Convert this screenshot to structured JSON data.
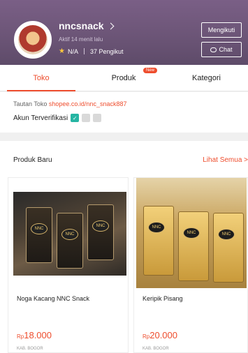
{
  "shop": {
    "name": "nncsnack",
    "active_status": "Aktif 14 menit lalu",
    "rating": "N/A",
    "followers": "37 Pengikut",
    "follow_label": "Mengikuti",
    "chat_label": "Chat"
  },
  "tabs": {
    "toko": "Toko",
    "produk": "Produk",
    "kategori": "Kategori",
    "new_badge": "New"
  },
  "info": {
    "link_label": "Tautan Toko",
    "link_url": "shopee.co.id/nnc_snack887",
    "verified_label": "Akun Terverifikasi"
  },
  "products_section": {
    "title": "Produk Baru",
    "see_all": "Lihat Semua >",
    "items": [
      {
        "name": "Noga Kacang NNC Snack",
        "currency": "Rp",
        "price": "18.000",
        "location": "KAB. BOGOR",
        "brand": "NNC"
      },
      {
        "name": "Keripik Pisang",
        "currency": "Rp",
        "price": "20.000",
        "location": "KAB. BOGOR",
        "brand": "NNC"
      }
    ]
  },
  "colors": {
    "accent": "#ee4d2d",
    "header": "#6c5577",
    "verified": "#26b5a3"
  }
}
